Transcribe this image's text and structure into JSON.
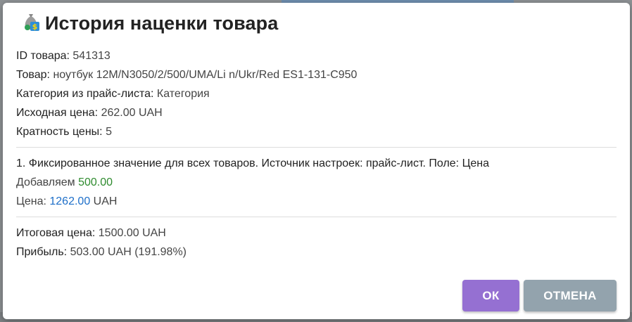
{
  "dialog": {
    "title": "История наценки товара",
    "icon": "money-bag-icon"
  },
  "product": {
    "id_label": "ID товара:",
    "id_value": "541313",
    "name_label": "Товар:",
    "name_value": "ноутбук 12M/N3050/2/500/UMA/Li n/Ukr/Red ES1-131-C950",
    "category_label": "Категория из прайс-листа:",
    "category_value": "Категория",
    "base_price_label": "Исходная цена:",
    "base_price_value": "262.00 UAH",
    "multiplicity_label": "Кратность цены:",
    "multiplicity_value": "5"
  },
  "rule": {
    "heading": "1. Фиксированное значение для всех товаров. Источник настроек: прайс-лист. Поле: Цена",
    "added_label": "Добавляем",
    "added_value": "500.00",
    "price_label": "Цена:",
    "price_value": "1262.00",
    "price_currency": "UAH"
  },
  "summary": {
    "final_label": "Итоговая цена:",
    "final_value": "1500.00 UAH",
    "profit_label": "Прибыль:",
    "profit_value": "503.00 UAH (191.98%)"
  },
  "buttons": {
    "ok": "ОК",
    "cancel": "ОТМЕНА"
  },
  "colors": {
    "ok_button": "#9570d2",
    "cancel_button": "#93a3ad",
    "added_value": "#2e8b2e",
    "price_value": "#1e6fc9"
  }
}
